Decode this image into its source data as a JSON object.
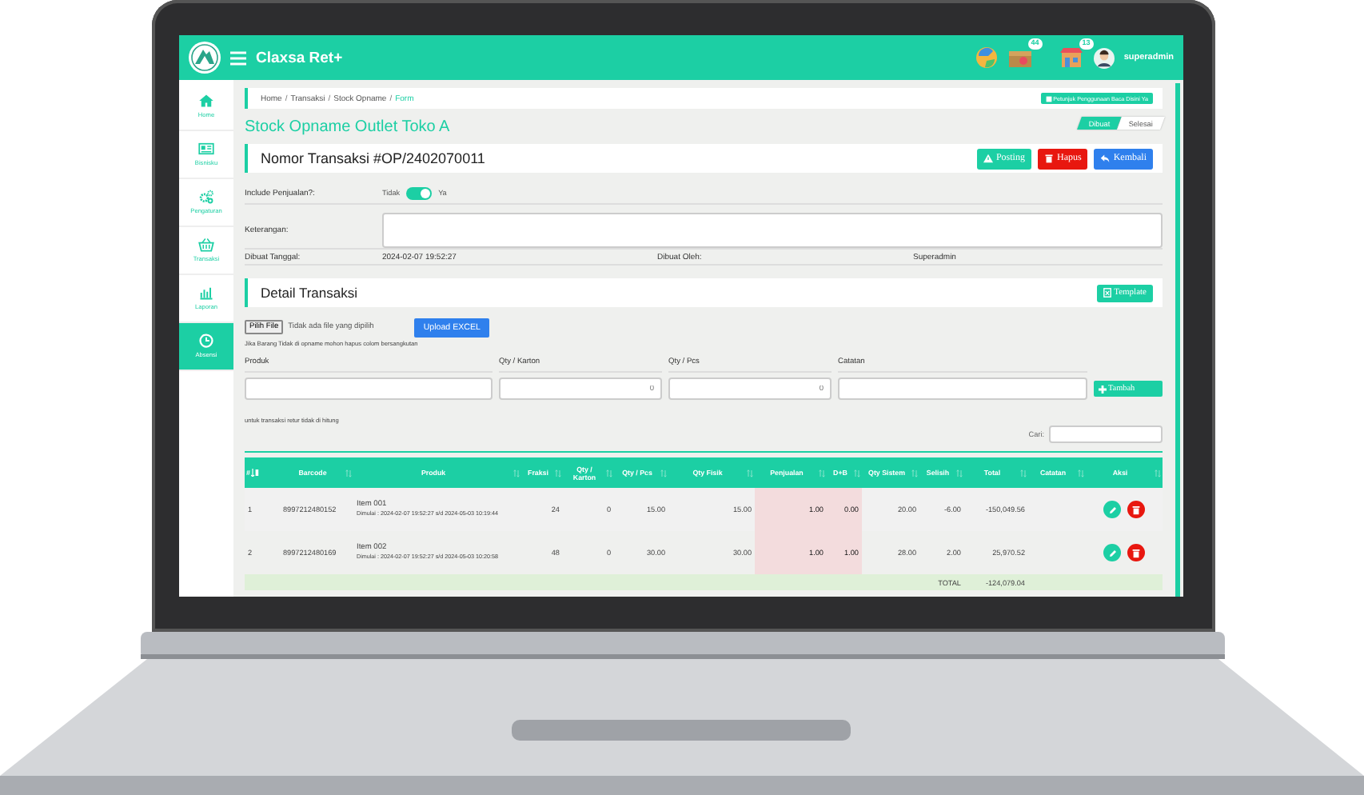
{
  "app": {
    "title": "Claxsa Ret+",
    "badges": [
      "44",
      "13"
    ],
    "user": "superadmin"
  },
  "sidebar": {
    "items": [
      {
        "label": "Home",
        "selected": false
      },
      {
        "label": "Bisnisku",
        "selected": false
      },
      {
        "label": "Pengaturan",
        "selected": false
      },
      {
        "label": "Transaksi",
        "selected": false
      },
      {
        "label": "Laporan",
        "selected": false
      },
      {
        "label": "Absensi",
        "selected": true
      }
    ]
  },
  "breadcrumb": [
    {
      "label": "Home",
      "separator": "/"
    },
    {
      "label": "Transaksi",
      "separator": "/"
    },
    {
      "label": "Stock Opname",
      "separator": "/"
    },
    {
      "label": "Form"
    }
  ],
  "help_button": "Petunjuk Penggunaan Baca Disini Ya",
  "page_title": "Stock Opname Outlet Toko A",
  "status_steps": [
    {
      "label": "Dibuat",
      "selected": true
    },
    {
      "label": "Selesai",
      "selected": false
    }
  ],
  "transaction": {
    "title": "Nomor Transaksi #OP/2402070011",
    "buttons": [
      {
        "label": "Posting",
        "kind": "posting"
      },
      {
        "label": "Hapus",
        "kind": "delete"
      },
      {
        "label": "Kembali",
        "kind": "back"
      }
    ]
  },
  "form": {
    "include_label": "Include Penjualan?:",
    "toggle_off_label": "Tidak",
    "toggle_on_label": "Ya",
    "include_on": true,
    "note_label": "Keterangan:",
    "created_date_label": "Dibuat Tanggal:",
    "created_date": "2024-02-07 19:52:27",
    "created_by_label": "Dibuat Oleh:",
    "created_by": "Superadmin"
  },
  "detail": {
    "title": "Detail Transaksi",
    "template_button": "Template",
    "file_button": "Pilih File",
    "file_status": "Tidak ada file yang dipilih",
    "upload_button": "Upload EXCEL",
    "hint": "Jika Barang Tidak di opname mohon hapus colom bersangkutan",
    "entry_fields": [
      {
        "label": "Produk",
        "kind": "text"
      },
      {
        "label": "Qty / Karton",
        "kind": "number",
        "value": "0"
      },
      {
        "label": "Qty / Pcs",
        "kind": "number",
        "value": "0"
      },
      {
        "label": "Catatan",
        "kind": "text"
      }
    ],
    "add_button": "Tambah",
    "return_note": "untuk transaksi retur tidak di hitung",
    "search_label": "Cari:"
  },
  "table": {
    "columns": [
      {
        "label": "#",
        "highlighted": false
      },
      {
        "label": "Barcode",
        "highlighted": false
      },
      {
        "label": "Produk",
        "highlighted": false
      },
      {
        "label": "Fraksi",
        "highlighted": false
      },
      {
        "label": "Qty / Karton",
        "highlighted": false
      },
      {
        "label": "Qty / Pcs",
        "highlighted": false
      },
      {
        "label": "Qty Fisik",
        "highlighted": false
      },
      {
        "label": "Penjualan",
        "highlighted": true
      },
      {
        "label": "D+B",
        "highlighted": true
      },
      {
        "label": "Qty Sistem",
        "highlighted": false
      },
      {
        "label": "Selisih",
        "highlighted": false
      },
      {
        "label": "Total",
        "highlighted": false
      },
      {
        "label": "Catatan",
        "highlighted": false
      },
      {
        "label": "Aksi",
        "highlighted": false
      }
    ],
    "rows": [
      {
        "number": "1",
        "barcode": "8997212480152",
        "product": "Item 001",
        "period": "Dimulai : 2024-02-07 19:52:27 s/d 2024-05-03 10:19:44",
        "values": [
          "24",
          "0",
          "15.00",
          "15.00",
          "1.00",
          "0.00",
          "20.00",
          "-6.00",
          "-150,049.56"
        ]
      },
      {
        "number": "2",
        "barcode": "8997212480169",
        "product": "Item 002",
        "period": "Dimulai : 2024-02-07 19:52:27 s/d 2024-05-03 10:20:58",
        "values": [
          "48",
          "0",
          "30.00",
          "30.00",
          "1.00",
          "1.00",
          "28.00",
          "2.00",
          "25,970.52"
        ]
      }
    ],
    "total_label": "TOTAL",
    "total": "-124,079.04"
  }
}
